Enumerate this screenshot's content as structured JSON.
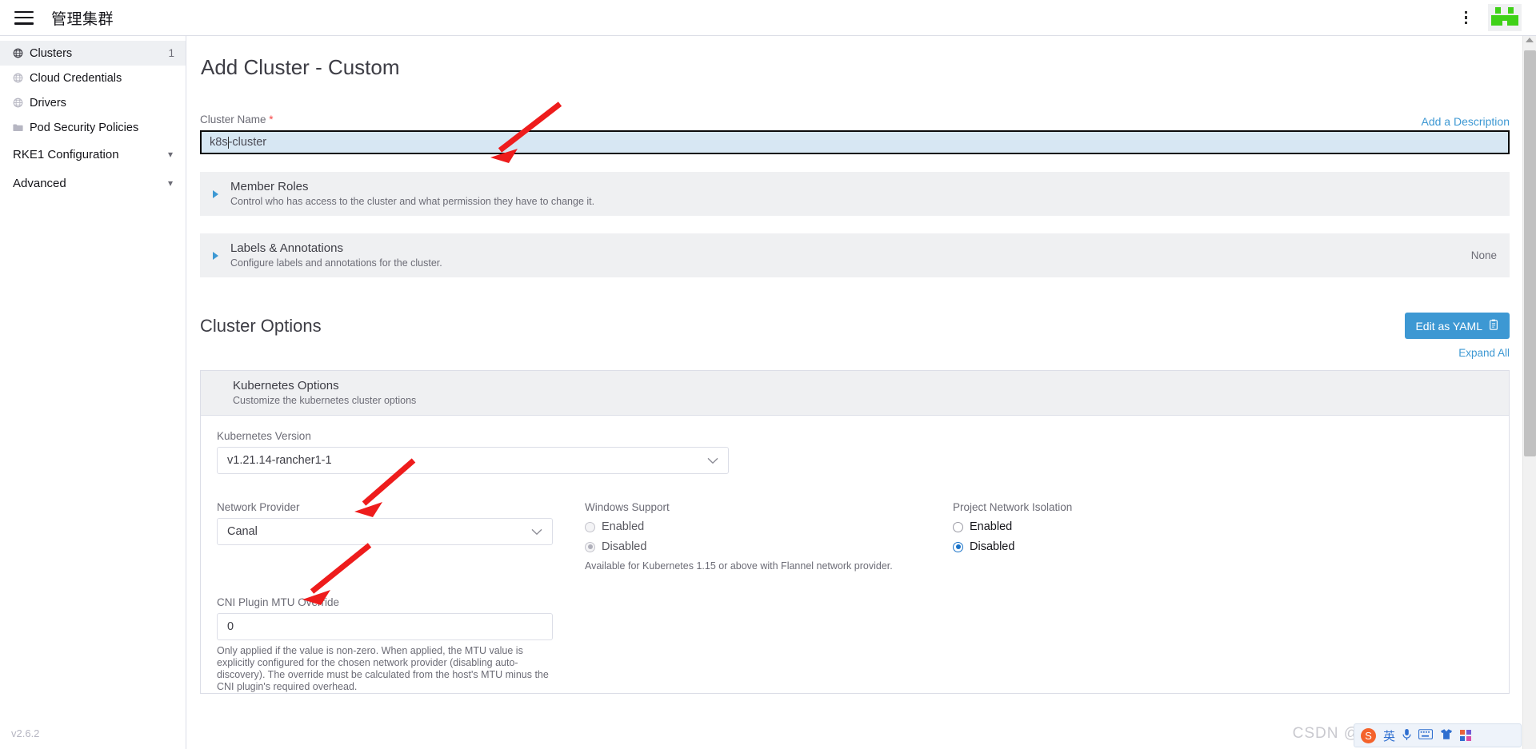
{
  "header": {
    "title": "管理集群",
    "menu_icon": "hamburger-icon",
    "kebab_icon": "more-vertical-icon",
    "logo_icon": "rancher-logo-icon"
  },
  "sidebar": {
    "items": [
      {
        "label": "Clusters",
        "icon": "globe-icon",
        "count": "1",
        "active": true
      },
      {
        "label": "Cloud Credentials",
        "icon": "globe-icon",
        "count": "",
        "active": false
      },
      {
        "label": "Drivers",
        "icon": "globe-icon",
        "count": "",
        "active": false
      },
      {
        "label": "Pod Security Policies",
        "icon": "folder-icon",
        "count": "",
        "active": false
      }
    ],
    "groups": [
      {
        "label": "RKE1 Configuration",
        "chevron": "chevron-down-icon"
      },
      {
        "label": "Advanced",
        "chevron": "chevron-down-icon"
      }
    ],
    "version": "v2.6.2"
  },
  "main": {
    "page_title": "Add Cluster - Custom",
    "cluster_name": {
      "label": "Cluster Name",
      "required_mark": "*",
      "value": "k8s",
      "value_tail": "-cluster",
      "add_description_link": "Add a Description"
    },
    "banners": [
      {
        "title": "Member Roles",
        "subtitle": "Control who has access to the cluster and what permission they have to change it.",
        "right": "",
        "expanded": false
      },
      {
        "title": "Labels & Annotations",
        "subtitle": "Configure labels and annotations for the cluster.",
        "right": "None",
        "expanded": false
      }
    ],
    "cluster_options": {
      "title": "Cluster Options",
      "edit_yaml_button": "Edit as YAML",
      "edit_yaml_icon": "clipboard-icon",
      "expand_all_link": "Expand All",
      "kubernetes_options": {
        "title": "Kubernetes Options",
        "subtitle": "Customize the kubernetes cluster options",
        "expanded": true,
        "kubernetes_version": {
          "label": "Kubernetes Version",
          "value": "v1.21.14-rancher1-1",
          "chevron": "chevron-down-icon"
        },
        "network_provider": {
          "label": "Network Provider",
          "value": "Canal",
          "chevron": "chevron-down-icon"
        },
        "windows_support": {
          "label": "Windows Support",
          "options": [
            {
              "label": "Enabled",
              "selected": false
            },
            {
              "label": "Disabled",
              "selected": true
            }
          ],
          "disabled": true,
          "hint": "Available for Kubernetes 1.15 or above with Flannel network provider."
        },
        "project_network_isolation": {
          "label": "Project Network Isolation",
          "options": [
            {
              "label": "Enabled",
              "selected": false
            },
            {
              "label": "Disabled",
              "selected": true
            }
          ],
          "disabled": false
        },
        "cni_plugin_mtu_override": {
          "label": "CNI Plugin MTU Override",
          "value": "0",
          "hint": "Only applied if the value is non-zero. When applied, the MTU value is explicitly configured for the chosen network provider (disabling auto-discovery). The override must be calculated from the host's MTU minus the CNI plugin's required overhead."
        }
      }
    }
  },
  "overlay": {
    "watermark": "CSDN @茶叶上上木",
    "ime": {
      "logo": "S",
      "mode": "英",
      "mic_icon": "microphone-icon",
      "keyboard_icon": "keyboard-icon",
      "tools_icon": "tshirt-icon",
      "apps_icon": "grid-apps-icon"
    }
  },
  "colors": {
    "accent": "#3d98d3",
    "brand_green": "#3fd118",
    "required_red": "#f64747",
    "arrow_red": "#ee1c1c",
    "banner_bg": "#eff0f2",
    "input_focus_bg": "#d7e7f3"
  }
}
